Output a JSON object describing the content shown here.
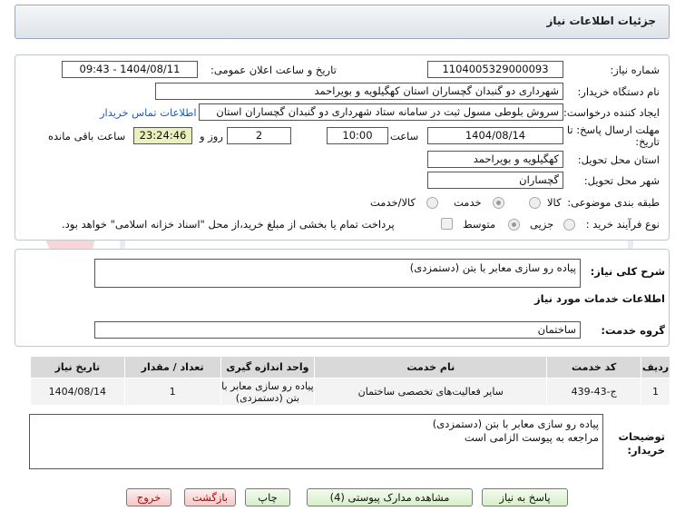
{
  "title": "جزئیات اطلاعات نیاز",
  "need_number": {
    "label": "شماره نیاز:",
    "value": "1104005329000093"
  },
  "announce_datetime": {
    "label": "تاریخ و ساعت اعلان عمومی:",
    "value": "1404/08/11 - 09:43"
  },
  "buyer_org": {
    "label": "نام دستگاه خریدار:",
    "value": "شهرداری دو گنبدان گچساران استان کهگیلویه و بویراحمد"
  },
  "requester": {
    "label": "ایجاد کننده درخواست:",
    "value": "سروش بلوطی مسول ثبت در سامانه ستاد شهرداری دو گنبدان گچساران استان",
    "contact_link": "اطلاعات تماس خریدار"
  },
  "deadline": {
    "label": "مهلت ارسال پاسخ: تا تاریخ:",
    "date": "1404/08/14",
    "time_label": "ساعت",
    "time": "10:00",
    "days": "2",
    "days_label": "روز و",
    "remaining": "23:24:46",
    "remaining_label": "ساعت باقی مانده"
  },
  "province": {
    "label": "استان محل تحویل:",
    "value": "کهگیلویه و بویراحمد"
  },
  "city": {
    "label": "شهر محل تحویل:",
    "value": "گچساران"
  },
  "category": {
    "label": "طبقه بندی موضوعی:",
    "options": [
      "کالا",
      "خدمت",
      "کالا/خدمت"
    ],
    "selected": "خدمت"
  },
  "purchase_type": {
    "label": "نوع فرآیند خرید :",
    "options": [
      "جزیی",
      "متوسط"
    ],
    "selected": "متوسط",
    "payment_note": "پرداخت تمام یا بخشی از مبلغ خرید،از محل \"اسناد خزانه اسلامی\" خواهد بود."
  },
  "overall_desc": {
    "label": "شرح کلی نیاز:",
    "value": "پیاده رو سازی معابر با بتن (دستمزدی)"
  },
  "services_heading": "اطلاعات خدمات مورد نیاز",
  "service_group": {
    "label": "گروه خدمت:",
    "value": "ساختمان"
  },
  "table": {
    "headers": [
      "ردیف",
      "کد خدمت",
      "نام خدمت",
      "واحد اندازه گیری",
      "تعداد / مقدار",
      "تاریخ نیاز"
    ],
    "rows": [
      [
        "1",
        "ج-43-439",
        "سایر فعالیت‌های تخصصی ساختمان",
        "پیاده رو سازی معابر با بتن (دستمزدی)",
        "1",
        "1404/08/14"
      ]
    ]
  },
  "buyer_notes": {
    "label": "توضیحات خریدار:",
    "line1": "پیاده رو سازی معابر با بتن (دستمزدی)",
    "line2": "مراجعه به پیوست الزامی است"
  },
  "buttons": {
    "reply": "پاسخ به نیاز",
    "view_docs": "مشاهده مدارک پیوستی (4)",
    "print": "چاپ",
    "back": "بازگشت",
    "exit": "خروج"
  },
  "colors": {
    "title_bg": "#dfe4ea",
    "green_button": "#d7efc8",
    "red_button": "#f5c9c9",
    "link": "#1a5fb4"
  }
}
